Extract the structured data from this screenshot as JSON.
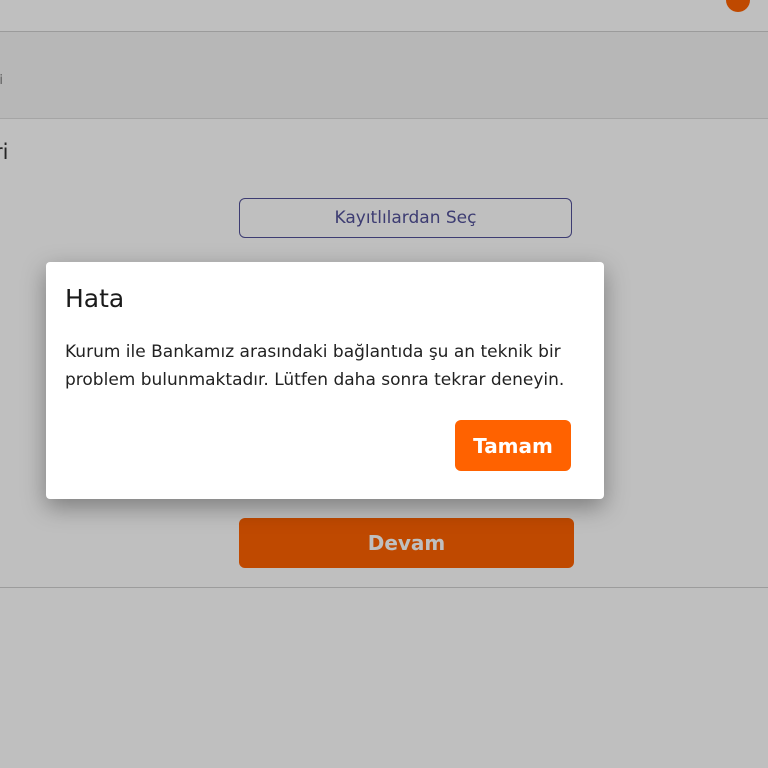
{
  "breadcrumb": {
    "text": "ri"
  },
  "section": {
    "title": "ri"
  },
  "buttons": {
    "select_saved": "Kayıtlılardan Seç",
    "continue": "Devam"
  },
  "dialog": {
    "title": "Hata",
    "message": "Kurum ile Bankamız arasındaki bağlantıda şu an teknik bir problem bulunmaktadır. Lütfen daha sonra tekrar deneyin.",
    "ok_label": "Tamam"
  },
  "colors": {
    "accent": "#ff6200",
    "secondary": "#525199"
  }
}
